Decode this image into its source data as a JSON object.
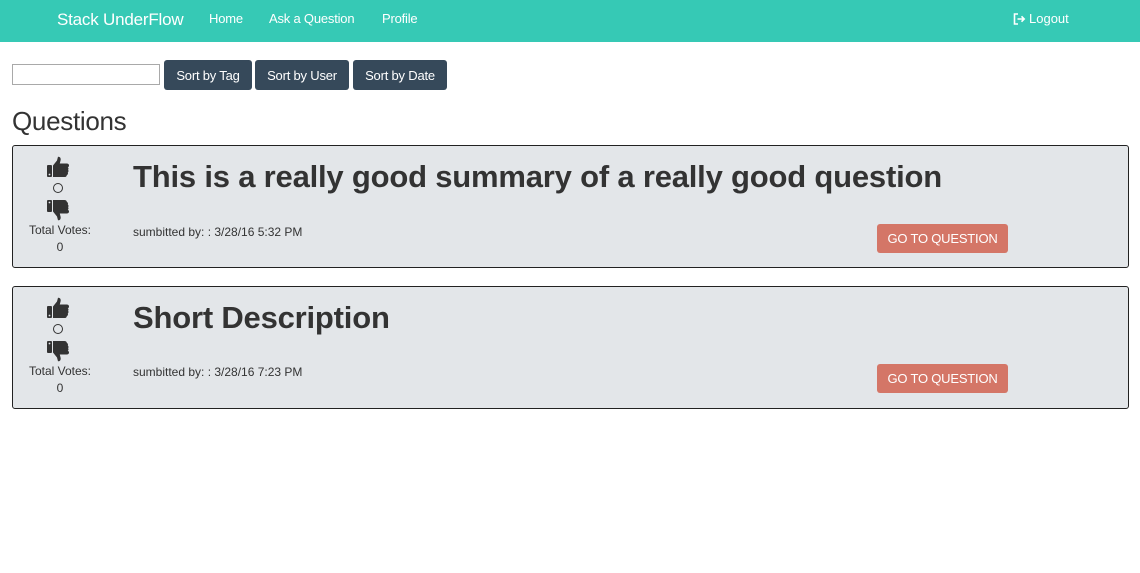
{
  "navbar": {
    "brand": "Stack UnderFlow",
    "links": [
      "Home",
      "Ask a Question",
      "Profile"
    ],
    "logout": "Logout",
    "logout_icon": "sign-out-icon",
    "color": "#36c9b5"
  },
  "toolbar": {
    "search_value": "",
    "search_placeholder": "",
    "sort_buttons": [
      "Sort by Tag",
      "Sort by User",
      "Sort by Date"
    ],
    "button_color": "#36495a"
  },
  "section_title": "Questions",
  "questions": [
    {
      "title": "This is a really good summary of a really good question",
      "meta": "sumbitted by: : 3/28/16 5:32 PM",
      "votes_label": "Total Votes:",
      "votes": "0",
      "button": "GO TO QUESTION"
    },
    {
      "title": "Short Description",
      "meta": "sumbitted by: : 3/28/16 7:23 PM",
      "votes_label": "Total Votes:",
      "votes": "0",
      "button": "GO TO QUESTION"
    }
  ],
  "colors": {
    "card_bg": "#e3e6e9",
    "go_button": "#d47667"
  }
}
